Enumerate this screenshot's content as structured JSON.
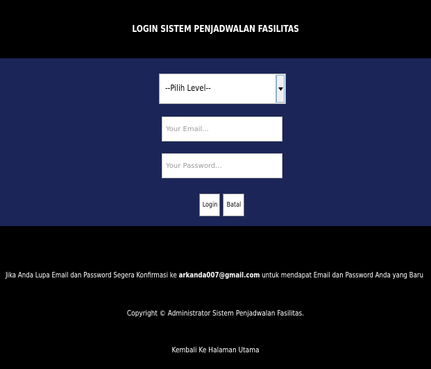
{
  "header": {
    "title": "LOGIN SISTEM PENJADWALAN FASILITAS"
  },
  "form": {
    "level_select": {
      "selected": "--Pilih Level--"
    },
    "email": {
      "placeholder": "Your Email...",
      "value": ""
    },
    "password": {
      "placeholder": "Your Password...",
      "value": ""
    },
    "login_label": "Login",
    "cancel_label": "Batal"
  },
  "footer": {
    "info_prefix": "Jika Anda Lupa Email dan Password Segera Konfirmasi ke ",
    "info_email": "arkanda007@gmail.com",
    "info_suffix": " untuk mendapat Email dan Password Anda yang Baru",
    "copyright_prefix": "Copyright © ",
    "copyright_owner": "Administrator Sistem Penjadwalan Fasilitas.",
    "back_link": "Kembali Ke Halaman Utama"
  },
  "colors": {
    "background": "#000000",
    "panel": "#1b2557",
    "text": "#ffffff"
  }
}
